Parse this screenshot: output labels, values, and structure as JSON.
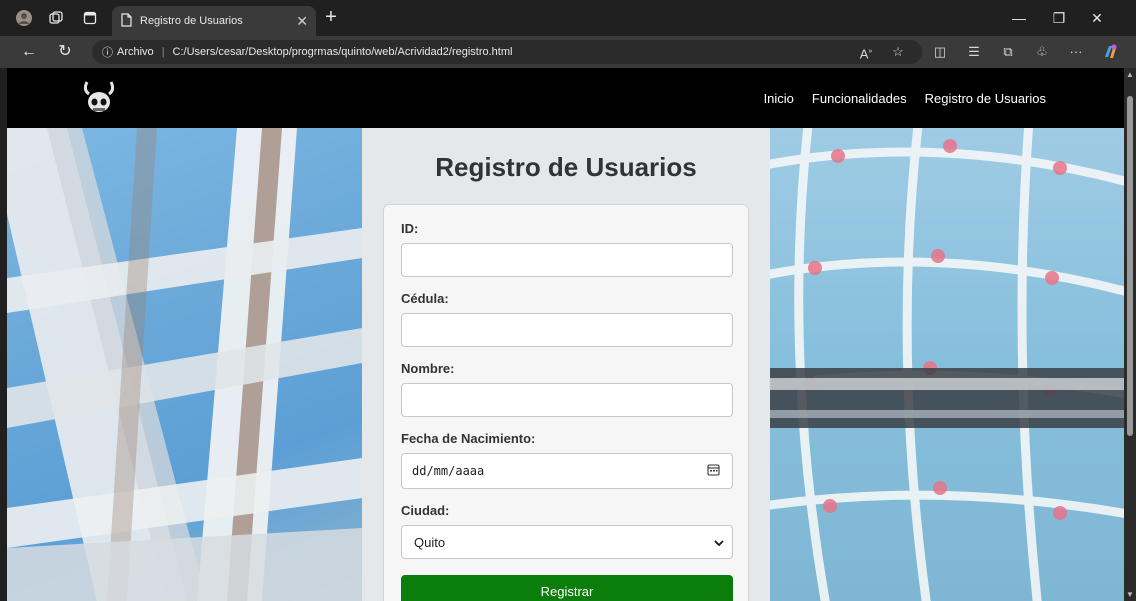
{
  "browser": {
    "tab_title": "Registro de Usuarios",
    "url_scheme_label": "Archivo",
    "url": "C:/Users/cesar/Desktop/progrmas/quinto/web/Acrividad2/registro.html"
  },
  "site_nav": {
    "links": [
      "Inicio",
      "Funcionalidades",
      "Registro de Usuarios"
    ]
  },
  "form": {
    "title": "Registro de Usuarios",
    "fields": {
      "id_label": "ID:",
      "cedula_label": "Cédula:",
      "nombre_label": "Nombre:",
      "fecha_label": "Fecha de Nacimiento:",
      "fecha_placeholder": "dd/mm/aaaa",
      "ciudad_label": "Ciudad:",
      "ciudad_selected": "Quito"
    },
    "submit_label": "Registrar"
  },
  "colors": {
    "submit": "#0b7d0b",
    "nav_bg": "#000000"
  }
}
